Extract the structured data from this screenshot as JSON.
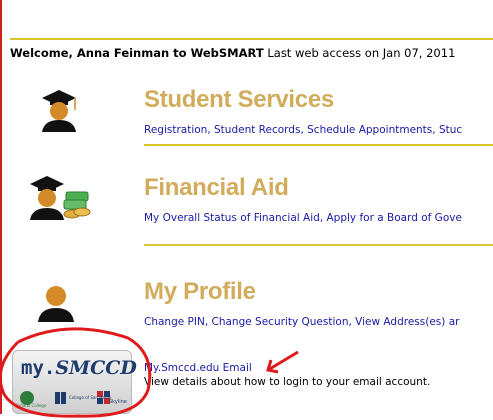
{
  "header": {
    "welcome_bold": "Welcome, Anna Feinman to WebSMART",
    "last_access": " Last web access on Jan 07, 2011"
  },
  "sections": [
    {
      "title": "Student Services",
      "icon": "graduate-icon",
      "links": [
        "Registration",
        "Student Records",
        "Schedule Appointments",
        "Stuc"
      ]
    },
    {
      "title": "Financial Aid",
      "icon": "graduate-money-icon",
      "links": [
        "My Overall Status of Financial Aid",
        "Apply for a Board of Gove"
      ]
    },
    {
      "title": "My Profile",
      "icon": "person-icon",
      "links": [
        "Change PIN",
        "Change Security Question",
        "View Address(es) ar"
      ]
    }
  ],
  "email": {
    "link": "My.Smccd.edu Email",
    "description": "View details about how to login to your email account."
  },
  "badge": {
    "logo_prefix": "my.",
    "logo_suffix": "SMCCD",
    "college_1": "Cañada College",
    "college_2": "College of San Mateo",
    "college_3": "Skyline"
  },
  "colors": {
    "accent_gold": "#d2ac5d",
    "rule": "#d6c52e",
    "link": "#1a1aa6",
    "annotation": "#e01a1a"
  }
}
